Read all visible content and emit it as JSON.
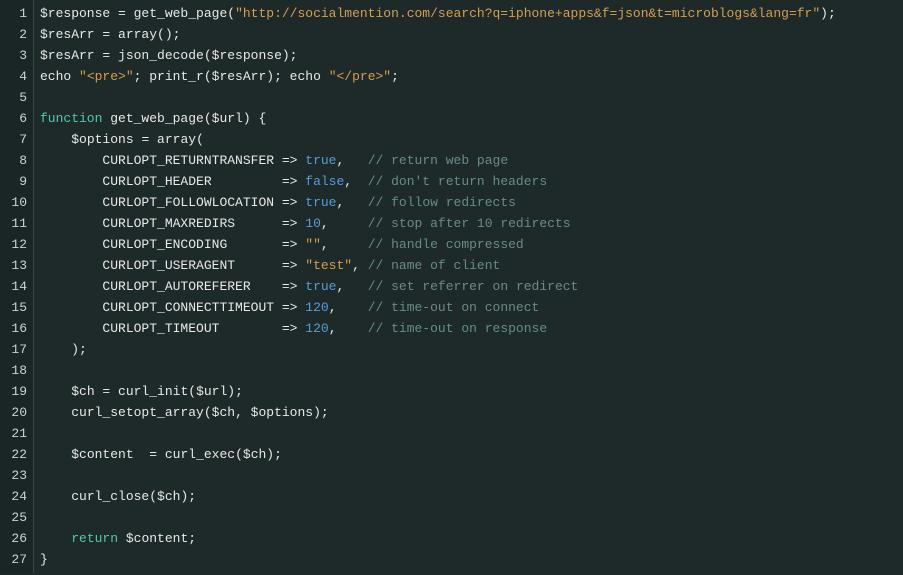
{
  "code": {
    "lines": [
      {
        "num": "1",
        "tokens": [
          {
            "cls": "tok-var",
            "t": "$response"
          },
          {
            "cls": "tok-op",
            "t": " = "
          },
          {
            "cls": "tok-func",
            "t": "get_web_page"
          },
          {
            "cls": "tok-punct",
            "t": "("
          },
          {
            "cls": "tok-str",
            "t": "\"http://socialmention.com/search?q=iphone+apps&f=json&t=microblogs&lang=fr\""
          },
          {
            "cls": "tok-punct",
            "t": ");"
          }
        ]
      },
      {
        "num": "2",
        "tokens": [
          {
            "cls": "tok-var",
            "t": "$resArr"
          },
          {
            "cls": "tok-op",
            "t": " = "
          },
          {
            "cls": "tok-func",
            "t": "array"
          },
          {
            "cls": "tok-punct",
            "t": "();"
          }
        ]
      },
      {
        "num": "3",
        "tokens": [
          {
            "cls": "tok-var",
            "t": "$resArr"
          },
          {
            "cls": "tok-op",
            "t": " = "
          },
          {
            "cls": "tok-func",
            "t": "json_decode"
          },
          {
            "cls": "tok-punct",
            "t": "("
          },
          {
            "cls": "tok-var",
            "t": "$response"
          },
          {
            "cls": "tok-punct",
            "t": ");"
          }
        ]
      },
      {
        "num": "4",
        "tokens": [
          {
            "cls": "tok-func",
            "t": "echo "
          },
          {
            "cls": "tok-str",
            "t": "\"<pre>\""
          },
          {
            "cls": "tok-punct",
            "t": "; "
          },
          {
            "cls": "tok-func",
            "t": "print_r"
          },
          {
            "cls": "tok-punct",
            "t": "("
          },
          {
            "cls": "tok-var",
            "t": "$resArr"
          },
          {
            "cls": "tok-punct",
            "t": "); "
          },
          {
            "cls": "tok-func",
            "t": "echo "
          },
          {
            "cls": "tok-str",
            "t": "\"</pre>\""
          },
          {
            "cls": "tok-punct",
            "t": ";"
          }
        ]
      },
      {
        "num": "5",
        "tokens": []
      },
      {
        "num": "6",
        "tokens": [
          {
            "cls": "tok-kw",
            "t": "function"
          },
          {
            "cls": "tok-func",
            "t": " get_web_page"
          },
          {
            "cls": "tok-punct",
            "t": "("
          },
          {
            "cls": "tok-var",
            "t": "$url"
          },
          {
            "cls": "tok-punct",
            "t": ") {"
          }
        ]
      },
      {
        "num": "7",
        "tokens": [
          {
            "cls": "tok-punct",
            "t": "    "
          },
          {
            "cls": "tok-var",
            "t": "$options"
          },
          {
            "cls": "tok-op",
            "t": " = "
          },
          {
            "cls": "tok-func",
            "t": "array"
          },
          {
            "cls": "tok-punct",
            "t": "("
          }
        ]
      },
      {
        "num": "8",
        "tokens": [
          {
            "cls": "tok-punct",
            "t": "        "
          },
          {
            "cls": "tok-const",
            "t": "CURLOPT_RETURNTRANSFER"
          },
          {
            "cls": "tok-op",
            "t": " => "
          },
          {
            "cls": "tok-bool",
            "t": "true"
          },
          {
            "cls": "tok-punct",
            "t": ",   "
          },
          {
            "cls": "tok-comment",
            "t": "// return web page"
          }
        ]
      },
      {
        "num": "9",
        "tokens": [
          {
            "cls": "tok-punct",
            "t": "        "
          },
          {
            "cls": "tok-const",
            "t": "CURLOPT_HEADER        "
          },
          {
            "cls": "tok-op",
            "t": " => "
          },
          {
            "cls": "tok-bool",
            "t": "false"
          },
          {
            "cls": "tok-punct",
            "t": ",  "
          },
          {
            "cls": "tok-comment",
            "t": "// don't return headers"
          }
        ]
      },
      {
        "num": "10",
        "tokens": [
          {
            "cls": "tok-punct",
            "t": "        "
          },
          {
            "cls": "tok-const",
            "t": "CURLOPT_FOLLOWLOCATION"
          },
          {
            "cls": "tok-op",
            "t": " => "
          },
          {
            "cls": "tok-bool",
            "t": "true"
          },
          {
            "cls": "tok-punct",
            "t": ",   "
          },
          {
            "cls": "tok-comment",
            "t": "// follow redirects"
          }
        ]
      },
      {
        "num": "11",
        "tokens": [
          {
            "cls": "tok-punct",
            "t": "        "
          },
          {
            "cls": "tok-const",
            "t": "CURLOPT_MAXREDIRS     "
          },
          {
            "cls": "tok-op",
            "t": " => "
          },
          {
            "cls": "tok-num",
            "t": "10"
          },
          {
            "cls": "tok-punct",
            "t": ",     "
          },
          {
            "cls": "tok-comment",
            "t": "// stop after 10 redirects"
          }
        ]
      },
      {
        "num": "12",
        "tokens": [
          {
            "cls": "tok-punct",
            "t": "        "
          },
          {
            "cls": "tok-const",
            "t": "CURLOPT_ENCODING      "
          },
          {
            "cls": "tok-op",
            "t": " => "
          },
          {
            "cls": "tok-str",
            "t": "\"\""
          },
          {
            "cls": "tok-punct",
            "t": ",     "
          },
          {
            "cls": "tok-comment",
            "t": "// handle compressed"
          }
        ]
      },
      {
        "num": "13",
        "tokens": [
          {
            "cls": "tok-punct",
            "t": "        "
          },
          {
            "cls": "tok-const",
            "t": "CURLOPT_USERAGENT     "
          },
          {
            "cls": "tok-op",
            "t": " => "
          },
          {
            "cls": "tok-str",
            "t": "\"test\""
          },
          {
            "cls": "tok-punct",
            "t": ", "
          },
          {
            "cls": "tok-comment",
            "t": "// name of client"
          }
        ]
      },
      {
        "num": "14",
        "tokens": [
          {
            "cls": "tok-punct",
            "t": "        "
          },
          {
            "cls": "tok-const",
            "t": "CURLOPT_AUTOREFERER   "
          },
          {
            "cls": "tok-op",
            "t": " => "
          },
          {
            "cls": "tok-bool",
            "t": "true"
          },
          {
            "cls": "tok-punct",
            "t": ",   "
          },
          {
            "cls": "tok-comment",
            "t": "// set referrer on redirect"
          }
        ]
      },
      {
        "num": "15",
        "tokens": [
          {
            "cls": "tok-punct",
            "t": "        "
          },
          {
            "cls": "tok-const",
            "t": "CURLOPT_CONNECTTIMEOUT"
          },
          {
            "cls": "tok-op",
            "t": " => "
          },
          {
            "cls": "tok-num",
            "t": "120"
          },
          {
            "cls": "tok-punct",
            "t": ",    "
          },
          {
            "cls": "tok-comment",
            "t": "// time-out on connect"
          }
        ]
      },
      {
        "num": "16",
        "tokens": [
          {
            "cls": "tok-punct",
            "t": "        "
          },
          {
            "cls": "tok-const",
            "t": "CURLOPT_TIMEOUT       "
          },
          {
            "cls": "tok-op",
            "t": " => "
          },
          {
            "cls": "tok-num",
            "t": "120"
          },
          {
            "cls": "tok-punct",
            "t": ",    "
          },
          {
            "cls": "tok-comment",
            "t": "// time-out on response"
          }
        ]
      },
      {
        "num": "17",
        "tokens": [
          {
            "cls": "tok-punct",
            "t": "    );"
          }
        ]
      },
      {
        "num": "18",
        "tokens": []
      },
      {
        "num": "19",
        "tokens": [
          {
            "cls": "tok-punct",
            "t": "    "
          },
          {
            "cls": "tok-var",
            "t": "$ch"
          },
          {
            "cls": "tok-op",
            "t": " = "
          },
          {
            "cls": "tok-func",
            "t": "curl_init"
          },
          {
            "cls": "tok-punct",
            "t": "("
          },
          {
            "cls": "tok-var",
            "t": "$url"
          },
          {
            "cls": "tok-punct",
            "t": ");"
          }
        ]
      },
      {
        "num": "20",
        "tokens": [
          {
            "cls": "tok-punct",
            "t": "    "
          },
          {
            "cls": "tok-func",
            "t": "curl_setopt_array"
          },
          {
            "cls": "tok-punct",
            "t": "("
          },
          {
            "cls": "tok-var",
            "t": "$ch"
          },
          {
            "cls": "tok-punct",
            "t": ", "
          },
          {
            "cls": "tok-var",
            "t": "$options"
          },
          {
            "cls": "tok-punct",
            "t": ");"
          }
        ]
      },
      {
        "num": "21",
        "tokens": []
      },
      {
        "num": "22",
        "tokens": [
          {
            "cls": "tok-punct",
            "t": "    "
          },
          {
            "cls": "tok-var",
            "t": "$content"
          },
          {
            "cls": "tok-op",
            "t": "  = "
          },
          {
            "cls": "tok-func",
            "t": "curl_exec"
          },
          {
            "cls": "tok-punct",
            "t": "("
          },
          {
            "cls": "tok-var",
            "t": "$ch"
          },
          {
            "cls": "tok-punct",
            "t": ");"
          }
        ]
      },
      {
        "num": "23",
        "tokens": []
      },
      {
        "num": "24",
        "tokens": [
          {
            "cls": "tok-punct",
            "t": "    "
          },
          {
            "cls": "tok-func",
            "t": "curl_close"
          },
          {
            "cls": "tok-punct",
            "t": "("
          },
          {
            "cls": "tok-var",
            "t": "$ch"
          },
          {
            "cls": "tok-punct",
            "t": ");"
          }
        ]
      },
      {
        "num": "25",
        "tokens": []
      },
      {
        "num": "26",
        "tokens": [
          {
            "cls": "tok-punct",
            "t": "    "
          },
          {
            "cls": "tok-kw",
            "t": "return"
          },
          {
            "cls": "tok-punct",
            "t": " "
          },
          {
            "cls": "tok-var",
            "t": "$content"
          },
          {
            "cls": "tok-punct",
            "t": ";"
          }
        ]
      },
      {
        "num": "27",
        "tokens": [
          {
            "cls": "tok-punct",
            "t": "}"
          }
        ]
      }
    ]
  }
}
